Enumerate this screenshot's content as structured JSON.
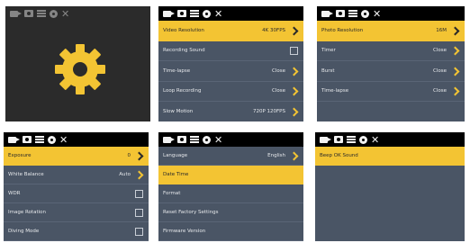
{
  "colors": {
    "accent": "#f3c433",
    "screen_bg": "#4a5565",
    "topbar_bg": "#000000",
    "dark_bg": "#2b2b2b"
  },
  "topbar_icons": [
    "video-icon",
    "photo-icon",
    "menu-icon",
    "settings-icon",
    "close-icon"
  ],
  "panels": {
    "p2": {
      "rows": [
        {
          "label": "Video Resolution",
          "value": "4K 30FPS"
        },
        {
          "label": "Recording Sound",
          "value": ""
        },
        {
          "label": "Time-lapse",
          "value": "Close"
        },
        {
          "label": "Loop Recording",
          "value": "Close"
        },
        {
          "label": "Slow Motion",
          "value": "720P 120FPS"
        }
      ]
    },
    "p3": {
      "rows": [
        {
          "label": "Photo Resolution",
          "value": "16M"
        },
        {
          "label": "Timer",
          "value": "Close"
        },
        {
          "label": "Burst",
          "value": "Close"
        },
        {
          "label": "Time-lapse",
          "value": "Close"
        }
      ]
    },
    "p4": {
      "rows": [
        {
          "label": "Exposure",
          "value": "0"
        },
        {
          "label": "White Balance",
          "value": "Auto"
        },
        {
          "label": "WDR",
          "value": ""
        },
        {
          "label": "Image Rotation",
          "value": ""
        },
        {
          "label": "Diving Mode",
          "value": ""
        }
      ]
    },
    "p5": {
      "rows": [
        {
          "label": "Language",
          "value": "English"
        },
        {
          "label": "Date Time",
          "value": ""
        },
        {
          "label": "Format",
          "value": ""
        },
        {
          "label": "Reset Factory Settings",
          "value": ""
        },
        {
          "label": "Firmware Version",
          "value": ""
        }
      ]
    },
    "p6": {
      "rows": [
        {
          "label": "Beep OK Sound",
          "value": ""
        }
      ]
    }
  }
}
